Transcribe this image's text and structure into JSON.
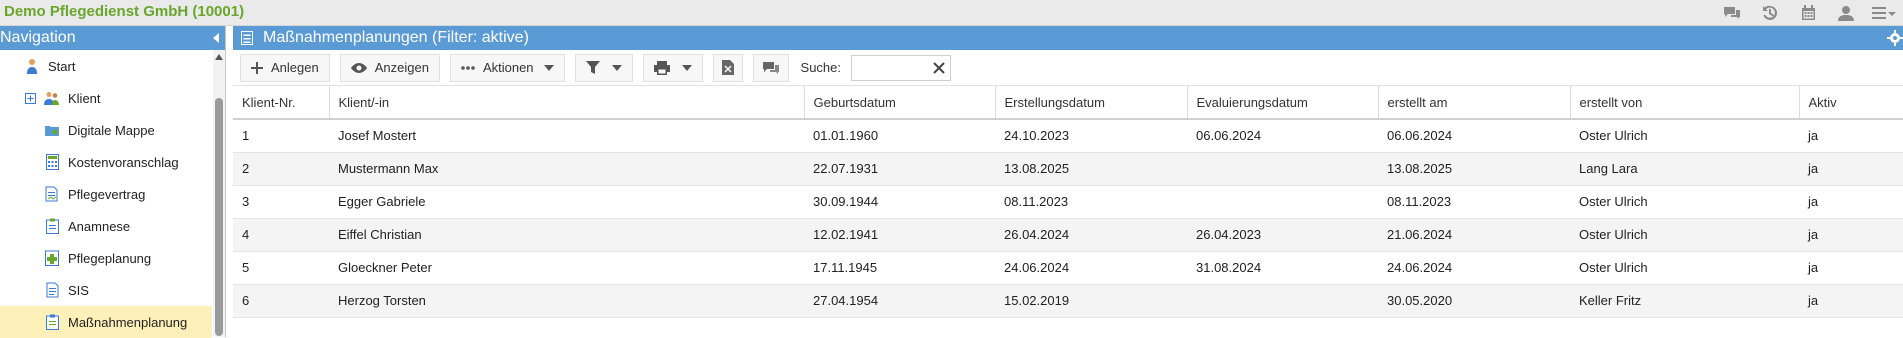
{
  "app": {
    "title": "Demo Pflegedienst GmbH (10001)"
  },
  "top_icons": [
    "chat-icon",
    "history-icon",
    "calendar-icon",
    "user-icon",
    "menu-icon"
  ],
  "nav": {
    "title": "Navigation",
    "items": [
      {
        "label": "Start",
        "icon": "start-icon"
      },
      {
        "label": "Klient",
        "icon": "client-icon"
      },
      {
        "label": "Digitale Mappe",
        "icon": "folder-icon"
      },
      {
        "label": "Kostenvoranschlag",
        "icon": "calc-icon"
      },
      {
        "label": "Pflegevertrag",
        "icon": "contract-icon"
      },
      {
        "label": "Anamnese",
        "icon": "clipboard-icon"
      },
      {
        "label": "Pflegeplanung",
        "icon": "plan-icon"
      },
      {
        "label": "SIS",
        "icon": "sis-icon"
      },
      {
        "label": "Maßnahmenplanung",
        "icon": "measures-icon"
      }
    ]
  },
  "main": {
    "title": "Maßnahmenplanungen (Filter: aktive)",
    "toolbar": {
      "add": "Anlegen",
      "view": "Anzeigen",
      "actions": "Aktionen",
      "search_label": "Suche:",
      "search_value": ""
    },
    "table": {
      "columns": [
        "Klient-Nr.",
        "Klient/-in",
        "Geburtsdatum",
        "Erstellungsdatum",
        "Evaluierungsdatum",
        "erstellt am",
        "erstellt von",
        "Aktiv"
      ],
      "rows": [
        [
          "1",
          "Josef Mostert",
          "01.01.1960",
          "24.10.2023",
          "06.06.2024",
          "06.06.2024",
          "Oster Ulrich",
          "ja"
        ],
        [
          "2",
          "Mustermann Max",
          "22.07.1931",
          "13.08.2025",
          "",
          "13.08.2025",
          "Lang Lara",
          "ja"
        ],
        [
          "3",
          "Egger Gabriele",
          "30.09.1944",
          "08.11.2023",
          "",
          "08.11.2023",
          "Oster Ulrich",
          "ja"
        ],
        [
          "4",
          "Eiffel Christian",
          "12.02.1941",
          "26.04.2024",
          "26.04.2023",
          "21.06.2024",
          "Oster Ulrich",
          "ja"
        ],
        [
          "5",
          "Gloeckner Peter",
          "17.11.1945",
          "24.06.2024",
          "31.08.2024",
          "24.06.2024",
          "Oster Ulrich",
          "ja"
        ],
        [
          "6",
          "Herzog Torsten",
          "27.04.1954",
          "15.02.2019",
          "",
          "30.05.2020",
          "Keller Fritz",
          "ja"
        ]
      ]
    }
  },
  "colors": {
    "accent": "#5b9bd5",
    "brand": "#6aa52c",
    "active_nav": "#fdf0b8"
  }
}
